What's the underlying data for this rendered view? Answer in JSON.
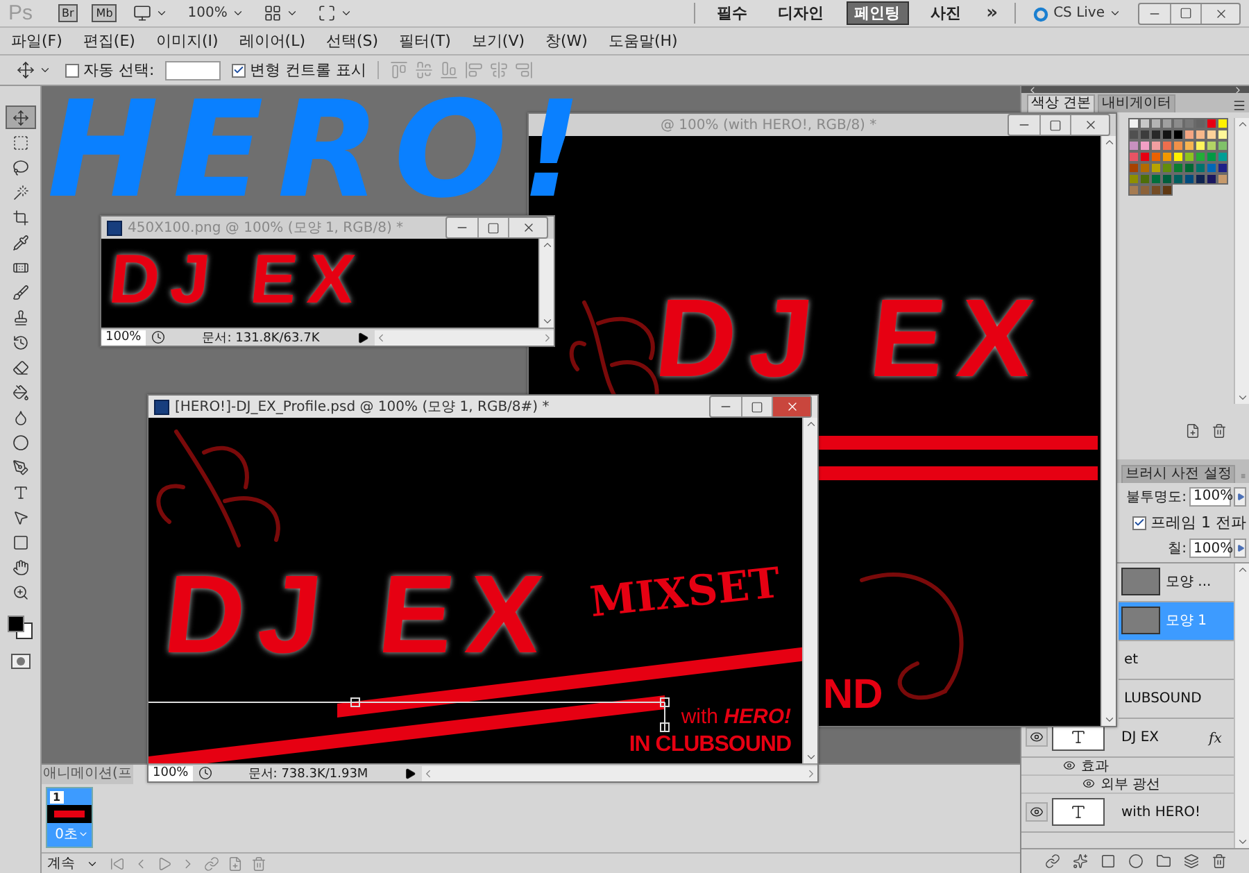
{
  "app_bar": {
    "logo": "Ps",
    "bridge": "Br",
    "mini_bridge": "Mb",
    "zoom": "100%",
    "workspaces": [
      {
        "label": "필수",
        "selected": false
      },
      {
        "label": "디자인",
        "selected": false
      },
      {
        "label": "페인팅",
        "selected": true
      },
      {
        "label": "사진",
        "selected": false
      }
    ],
    "more": "»",
    "cs_live": "CS Live"
  },
  "menu": [
    "파일(F)",
    "편집(E)",
    "이미지(I)",
    "레이어(L)",
    "선택(S)",
    "필터(T)",
    "보기(V)",
    "창(W)",
    "도움말(H)"
  ],
  "options_bar": {
    "auto_select": {
      "label": "자동 선택:",
      "checked": false
    },
    "show_transform": {
      "label": "변형 컨트롤 표시",
      "checked": true
    }
  },
  "overlay_title": "HERO!",
  "tools": [
    {
      "kind": "move",
      "selected": true
    },
    {
      "kind": "marquee",
      "selected": false
    },
    {
      "kind": "lasso",
      "selected": false
    },
    {
      "kind": "wand",
      "selected": false
    },
    {
      "kind": "crop",
      "selected": false
    },
    {
      "kind": "eyedropper",
      "selected": false
    },
    {
      "kind": "healing",
      "selected": false
    },
    {
      "kind": "brush",
      "selected": false
    },
    {
      "kind": "stamp",
      "selected": false
    },
    {
      "kind": "history",
      "selected": false
    },
    {
      "kind": "eraser",
      "selected": false
    },
    {
      "kind": "bucket",
      "selected": false
    },
    {
      "kind": "blur",
      "selected": false
    },
    {
      "kind": "dodge",
      "selected": false
    },
    {
      "kind": "pen",
      "selected": false
    },
    {
      "kind": "type",
      "selected": false
    },
    {
      "kind": "select",
      "selected": false
    },
    {
      "kind": "shape",
      "selected": false
    },
    {
      "kind": "hand",
      "selected": false
    },
    {
      "kind": "zoom",
      "selected": false
    }
  ],
  "windows": [
    {
      "kind": "back",
      "title": "@ 100% (with HERO!, RGB/8) *",
      "active": false,
      "logo": "DJ EX",
      "tail": "ND"
    },
    {
      "kind": "banner",
      "title": "450X100.png @ 100% (모양 1, RGB/8) *",
      "active": false,
      "logo": "DJ EX",
      "zoom": "100%",
      "doc_info": "문서: 131.8K/63.7K"
    },
    {
      "kind": "profile",
      "title": "[HERO!]-DJ_EX_Profile.psd @ 100% (모양 1, RGB/8#) *",
      "active": true,
      "logo": "DJ EX",
      "subtitle": "MIXSET",
      "credit": "with **HERO!**",
      "venue": "IN CLUBSOUND",
      "zoom": "100%",
      "doc_info": "문서: 738.3K/1.93M"
    }
  ],
  "swatches_panel": {
    "tabs": [
      {
        "label": "색상 견본",
        "selected": true
      },
      {
        "label": "내비게이터",
        "selected": false
      }
    ],
    "swatches": [
      {
        "color": "#f2f2f2"
      },
      {
        "color": "#c8c8c8"
      },
      {
        "color": "#b4b4b4"
      },
      {
        "color": "#a0a0a0"
      },
      {
        "color": "#8c8c8c"
      },
      {
        "color": "#787878"
      },
      {
        "color": "#646464"
      },
      {
        "color": "#e60012"
      },
      {
        "color": "#fff100"
      },
      {
        "color": "#505050"
      },
      {
        "color": "#3c3c3c"
      },
      {
        "color": "#282828"
      },
      {
        "color": "#141414"
      },
      {
        "color": "#000000"
      },
      {
        "color": "#f4a582"
      },
      {
        "color": "#f7b88a"
      },
      {
        "color": "#fbd29a"
      },
      {
        "color": "#fff799"
      },
      {
        "color": "#c891c0"
      },
      {
        "color": "#f29fc5"
      },
      {
        "color": "#f19ea0"
      },
      {
        "color": "#ee6e4d"
      },
      {
        "color": "#f19149"
      },
      {
        "color": "#f8b551"
      },
      {
        "color": "#fff45c"
      },
      {
        "color": "#b3d465"
      },
      {
        "color": "#80c269"
      },
      {
        "color": "#e95464"
      },
      {
        "color": "#e60012"
      },
      {
        "color": "#eb6100"
      },
      {
        "color": "#f39800"
      },
      {
        "color": "#fff100"
      },
      {
        "color": "#8fc31f"
      },
      {
        "color": "#22ac38"
      },
      {
        "color": "#009944"
      },
      {
        "color": "#009e96"
      },
      {
        "color": "#a84200"
      },
      {
        "color": "#b36b00"
      },
      {
        "color": "#b8a400"
      },
      {
        "color": "#638c0b"
      },
      {
        "color": "#0a7d30"
      },
      {
        "color": "#006934"
      },
      {
        "color": "#00736d"
      },
      {
        "color": "#0068b7"
      },
      {
        "color": "#1d2088"
      },
      {
        "color": "#8f8f00"
      },
      {
        "color": "#4d6e09"
      },
      {
        "color": "#006f3c"
      },
      {
        "color": "#005e3c"
      },
      {
        "color": "#005f5e"
      },
      {
        "color": "#004c7e"
      },
      {
        "color": "#0f2350"
      },
      {
        "color": "#1a1760"
      },
      {
        "color": "#c79a6b"
      },
      {
        "color": "#a67c52"
      },
      {
        "color": "#8c6239"
      },
      {
        "color": "#754c24"
      },
      {
        "color": "#603913"
      }
    ]
  },
  "layers_panel": {
    "tab": "브러시 사전 설정",
    "opacity_label": "불투명도:",
    "opacity": "100%",
    "propagate": {
      "label": "프레임 1 전파",
      "checked": true
    },
    "fill_label": "칠:",
    "fill": "100%",
    "layers": [
      {
        "kind": "shape",
        "name": "모양 ...",
        "selected": false
      },
      {
        "kind": "shape",
        "name": "모양 1",
        "selected": true
      },
      {
        "kind": "covered",
        "name": "et",
        "selected": false
      },
      {
        "kind": "covered",
        "name": "LUBSOUND",
        "selected": false
      },
      {
        "kind": "text",
        "name": "DJ EX",
        "selected": false,
        "visible": true,
        "fx": "fx",
        "effects": {
          "label": "효과",
          "items": [
            "외부 광선"
          ]
        }
      },
      {
        "kind": "text",
        "name": "with HERO!",
        "selected": false,
        "visible": true
      }
    ]
  },
  "animation_panel": {
    "tab": "애니메이션(프",
    "frames": [
      {
        "number": "1",
        "delay": "0초",
        "selected": true
      }
    ],
    "loop": "계속"
  }
}
